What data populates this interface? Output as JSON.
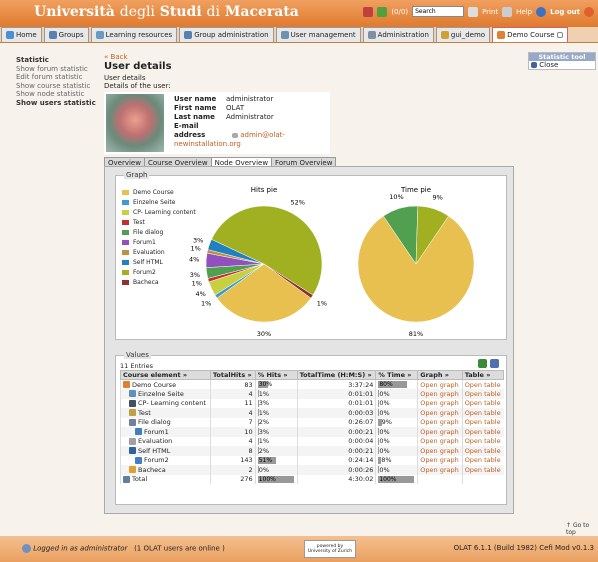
{
  "header": {
    "logo_part1": "Università",
    "logo_part2": "degli",
    "logo_part3": "Studi",
    "logo_part4": "di",
    "logo_part5": "Macerata",
    "count": "(0/0)",
    "search_value": "Search",
    "print": "Print",
    "help": "Help",
    "logout": "Log out"
  },
  "tabs": [
    "Home",
    "Groups",
    "Learning resources",
    "Group administration",
    "User management",
    "Administration",
    "gui_demo",
    "Demo Course"
  ],
  "leftnav": {
    "title": "Statistic",
    "items": [
      "Show forum statistic",
      "Edit forum statistic",
      "Show course statistic",
      "Show node statistic",
      "Show users statistic"
    ]
  },
  "main": {
    "back": "Back",
    "title": "User details",
    "subtitle": "User details",
    "subtitle2": "Details of the user:"
  },
  "user": {
    "username_label": "User name",
    "username": "administrator",
    "firstname_label": "First name",
    "firstname": "OLAT",
    "lastname_label": "Last name",
    "lastname": "Administrator",
    "email_label": "E-mail address",
    "email": "admin@olat-newinstallation.org"
  },
  "subtabs": [
    "Overview",
    "Course Overview",
    "Node Overview",
    "Forum Overview"
  ],
  "graph": {
    "legend_title": "Graph",
    "legend": [
      {
        "name": "Demo Course",
        "color": "#e8c050"
      },
      {
        "name": "Einzelne Seite",
        "color": "#3a9ad9"
      },
      {
        "name": "CP- Learning content",
        "color": "#c8d040"
      },
      {
        "name": "Test",
        "color": "#c03030"
      },
      {
        "name": "File dialog",
        "color": "#50a050"
      },
      {
        "name": "Forum1",
        "color": "#9050c0"
      },
      {
        "name": "Evaluation",
        "color": "#c09040"
      },
      {
        "name": "Self HTML",
        "color": "#2080c0"
      },
      {
        "name": "Forum2",
        "color": "#a0b020"
      },
      {
        "name": "Bacheca",
        "color": "#903030"
      }
    ]
  },
  "chart_data": [
    {
      "type": "pie",
      "title": "Hits pie",
      "labels": [
        "Demo Course",
        "Einzelne Seite",
        "CP- Learning content",
        "Test",
        "File dialog",
        "Forum1",
        "Evaluation",
        "Self HTML",
        "Forum2",
        "Bacheca"
      ],
      "values": [
        30,
        1,
        4,
        1,
        3,
        4,
        1,
        3,
        52,
        1
      ],
      "value_labels": [
        "30%",
        "1%",
        "4%",
        "1%",
        "3%",
        "4%",
        "1%",
        "3%",
        "52%",
        "1%"
      ]
    },
    {
      "type": "pie",
      "title": "Time pie",
      "labels": [
        "Demo Course",
        "Einzelne Seite",
        "CP- Learning content",
        "Test",
        "File dialog",
        "Forum1",
        "Evaluation",
        "Self HTML",
        "Forum2",
        "Bacheca"
      ],
      "values": [
        81,
        0,
        0,
        0,
        10,
        0,
        0,
        0,
        9,
        0
      ],
      "value_labels": [
        "81%",
        "0%",
        "0%",
        "0%",
        "10%",
        "0%",
        "0%",
        "0%",
        "9%",
        "0%"
      ]
    }
  ],
  "values": {
    "legend_title": "Values",
    "entries": "11 Entries",
    "columns": [
      "Course element",
      "TotalHits",
      "% Hits",
      "TotalTime (H:M:S)",
      "% Time",
      "Graph",
      "Table"
    ],
    "rows": [
      {
        "name": "Demo Course",
        "hits": "83",
        "phits": "30%",
        "hp": 30,
        "time": "3:37:24",
        "ptime": "80%",
        "tp": 80,
        "graph": "Open graph",
        "table": "Open table",
        "indent": 0,
        "icolor": "#e08030"
      },
      {
        "name": "Einzelne Seite",
        "hits": "4",
        "phits": "1%",
        "hp": 1,
        "time": "0:01:01",
        "ptime": "0%",
        "tp": 0,
        "graph": "Open graph",
        "table": "Open table",
        "indent": 1,
        "icolor": "#6090c0"
      },
      {
        "name": "CP- Learning content",
        "hits": "11",
        "phits": "3%",
        "hp": 3,
        "time": "0:01:01",
        "ptime": "0%",
        "tp": 0,
        "graph": "Open graph",
        "table": "Open table",
        "indent": 1,
        "icolor": "#405060"
      },
      {
        "name": "Test",
        "hits": "4",
        "phits": "1%",
        "hp": 1,
        "time": "0:00:03",
        "ptime": "0%",
        "tp": 0,
        "graph": "Open graph",
        "table": "Open table",
        "indent": 1,
        "icolor": "#c0a040"
      },
      {
        "name": "File dialog",
        "hits": "7",
        "phits": "2%",
        "hp": 2,
        "time": "0:26:07",
        "ptime": "9%",
        "tp": 9,
        "graph": "Open graph",
        "table": "Open table",
        "indent": 1,
        "icolor": "#7080a0"
      },
      {
        "name": "Forum1",
        "hits": "10",
        "phits": "3%",
        "hp": 3,
        "time": "0:00:21",
        "ptime": "0%",
        "tp": 0,
        "graph": "Open graph",
        "table": "Open table",
        "indent": 2,
        "icolor": "#4080c0"
      },
      {
        "name": "Evaluation",
        "hits": "4",
        "phits": "1%",
        "hp": 1,
        "time": "0:00:04",
        "ptime": "0%",
        "tp": 0,
        "graph": "Open graph",
        "table": "Open table",
        "indent": 1,
        "icolor": "#a0a0a0"
      },
      {
        "name": "Self HTML",
        "hits": "8",
        "phits": "2%",
        "hp": 2,
        "time": "0:00:21",
        "ptime": "0%",
        "tp": 0,
        "graph": "Open graph",
        "table": "Open table",
        "indent": 1,
        "icolor": "#3060a0"
      },
      {
        "name": "Forum2",
        "hits": "143",
        "phits": "51%",
        "hp": 51,
        "time": "0:24:14",
        "ptime": "8%",
        "tp": 8,
        "graph": "Open graph",
        "table": "Open table",
        "indent": 2,
        "icolor": "#4080c0"
      },
      {
        "name": "Bacheca",
        "hits": "2",
        "phits": "0%",
        "hp": 0,
        "time": "0:00:26",
        "ptime": "0%",
        "tp": 0,
        "graph": "Open graph",
        "table": "Open table",
        "indent": 1,
        "icolor": "#e0a030"
      },
      {
        "name": "Total",
        "hits": "276",
        "phits": "100%",
        "hp": 100,
        "time": "4:30:02",
        "ptime": "100%",
        "tp": 100,
        "graph": "",
        "table": "",
        "indent": 0,
        "icolor": "#6080a0"
      }
    ]
  },
  "sidebox": {
    "title": "Statistic tool",
    "close": "Close"
  },
  "goto_top": "Go to top",
  "footer": {
    "logged_in": "Logged in as administrator",
    "online": "(1 OLAT users are online )",
    "powered_by": "powered by",
    "university": "University of Zurich",
    "version": "OLAT 6.1.1 (Build 1982) Cefi Mod v0.1.3"
  }
}
